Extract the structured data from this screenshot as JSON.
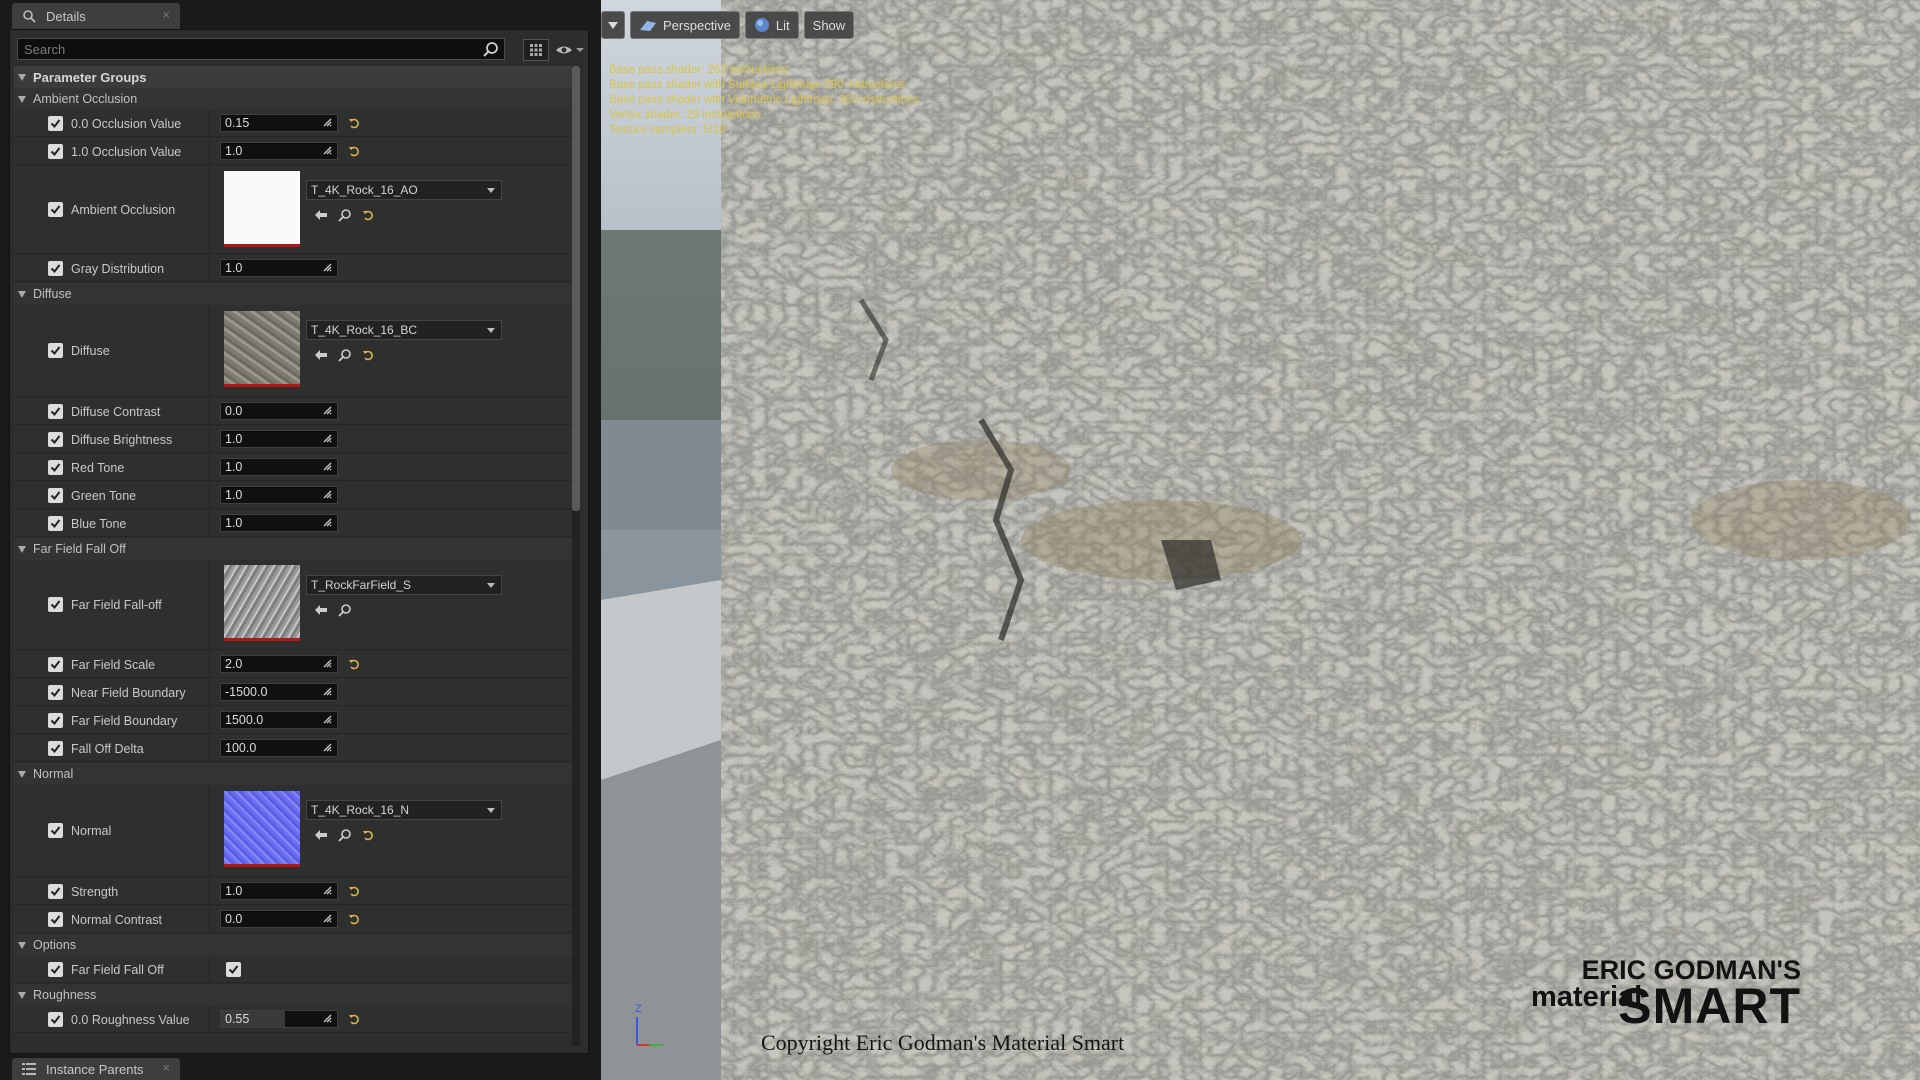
{
  "details_tab": {
    "title": "Details",
    "close": "×"
  },
  "instance_tab": {
    "title": "Instance Parents",
    "close": "×"
  },
  "search": {
    "placeholder": "Search",
    "value": ""
  },
  "param_header": "Parameter Groups",
  "groups": {
    "ambient_occlusion": "Ambient Occlusion",
    "diffuse": "Diffuse",
    "far_field": "Far Field Fall Off",
    "normal": "Normal",
    "options": "Options",
    "roughness": "Roughness"
  },
  "params": {
    "occ0_label": "0.0 Occlusion Value",
    "occ0_value": "0.15",
    "occ1_label": "1.0 Occlusion Value",
    "occ1_value": "1.0",
    "ao_label": "Ambient Occlusion",
    "ao_asset": "T_4K_Rock_16_AO",
    "gray_label": "Gray Distribution",
    "gray_value": "1.0",
    "diffuse_label": "Diffuse",
    "diffuse_asset": "T_4K_Rock_16_BC",
    "dcontrast_label": "Diffuse Contrast",
    "dcontrast_value": "0.0",
    "dbright_label": "Diffuse Brightness",
    "dbright_value": "1.0",
    "red_label": "Red Tone",
    "red_value": "1.0",
    "green_label": "Green Tone",
    "green_value": "1.0",
    "blue_label": "Blue Tone",
    "blue_value": "1.0",
    "ff_label": "Far Field Fall-off",
    "ff_asset": "T_RockFarField_S",
    "ffscale_label": "Far Field Scale",
    "ffscale_value": "2.0",
    "near_label": "Near Field Boundary",
    "near_value": "-1500.0",
    "far_label": "Far Field Boundary",
    "far_value": "1500.0",
    "delta_label": "Fall Off Delta",
    "delta_value": "100.0",
    "normal_label": "Normal",
    "normal_asset": "T_4K_Rock_16_N",
    "strength_label": "Strength",
    "strength_value": "1.0",
    "ncontrast_label": "Normal Contrast",
    "ncontrast_value": "0.0",
    "opt_ff_label": "Far Field Fall Off",
    "rough0_label": "0.0 Roughness Value",
    "rough0_value": "0.55"
  },
  "viewport": {
    "perspective": "Perspective",
    "lit": "Lit",
    "show": "Show",
    "stats": [
      "Base pass shader: 262 instructions",
      "Base pass shader with Surface Lightmap: 290 instructions",
      "Base pass shader with Volumetric Lightmap: 363 instructions",
      "Vertex shader: 29 instructions",
      "Texture samplers: 5/16"
    ],
    "copyright": "Copyright Eric Godman's Material Smart",
    "logo_line1": "ERIC GODMAN'S",
    "logo_line2": "material",
    "logo_line3": "SMART",
    "axis_z": "Z"
  },
  "colors": {
    "accent_reset": "#d9b84a",
    "thumb_underline": "#b01818",
    "normal_map": "#6a6ef0"
  }
}
